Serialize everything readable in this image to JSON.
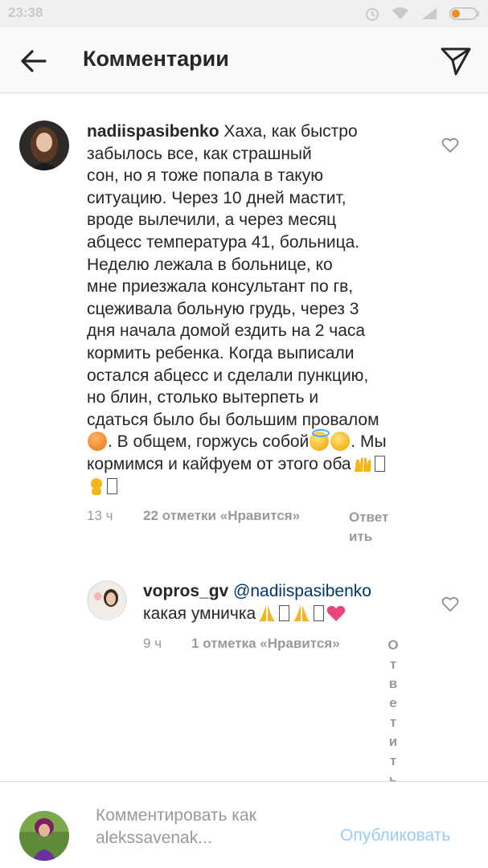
{
  "status_bar": {
    "time": "23:38"
  },
  "header": {
    "title": "Комментарии"
  },
  "comments": [
    {
      "username": "nadiispasibenko",
      "lines": [
        "Хаха, как быстро",
        "забылось все, как страшный",
        "сон, но я тоже попала в такую",
        "ситуацию. Через 10 дней мастит,",
        "вроде вылечили, а через месяц",
        "абцесс температура 41, больница.",
        "Неделю лежала в больнице, ко",
        "мне приезжала консультант по гв,",
        "сцеживала больную грудь, через 3",
        "дня начала домой ездить на 2 часа",
        "кормить ребенка. Когда выписали",
        "остался абцесс и сделали пункцию,",
        "но блин, столько вытерпеть и",
        "сдаться было бы большим провалом"
      ],
      "line15_a": ". В общем, горжусь собой",
      "line15_b": ". Мы",
      "line16": "кормимся и кайфуем от этого оба",
      "time": "13 ч",
      "likes": "22 отметки «Нравится»",
      "reply_line1": "Ответ",
      "reply_line2": "ить"
    },
    {
      "username": "vopros_gv",
      "mention": "@nadiispasibenko",
      "text": "какая умничка",
      "time": "9 ч",
      "likes": "1 отметка «Нравится»",
      "reply_chars": [
        "О",
        "т",
        "в",
        "е",
        "т",
        "и",
        "т",
        "ь"
      ]
    }
  ],
  "footer": {
    "placeholder_line1": "Комментировать как",
    "placeholder_line2": "alekssavenak...",
    "publish_label": "Опубликовать"
  },
  "icons": {
    "back": "arrow-left-icon",
    "send": "paper-plane-icon",
    "like": "heart-outline-icon"
  },
  "colors": {
    "text": "#262626",
    "muted": "#999999",
    "mention": "#003569",
    "publish": "#9bcbf7"
  }
}
